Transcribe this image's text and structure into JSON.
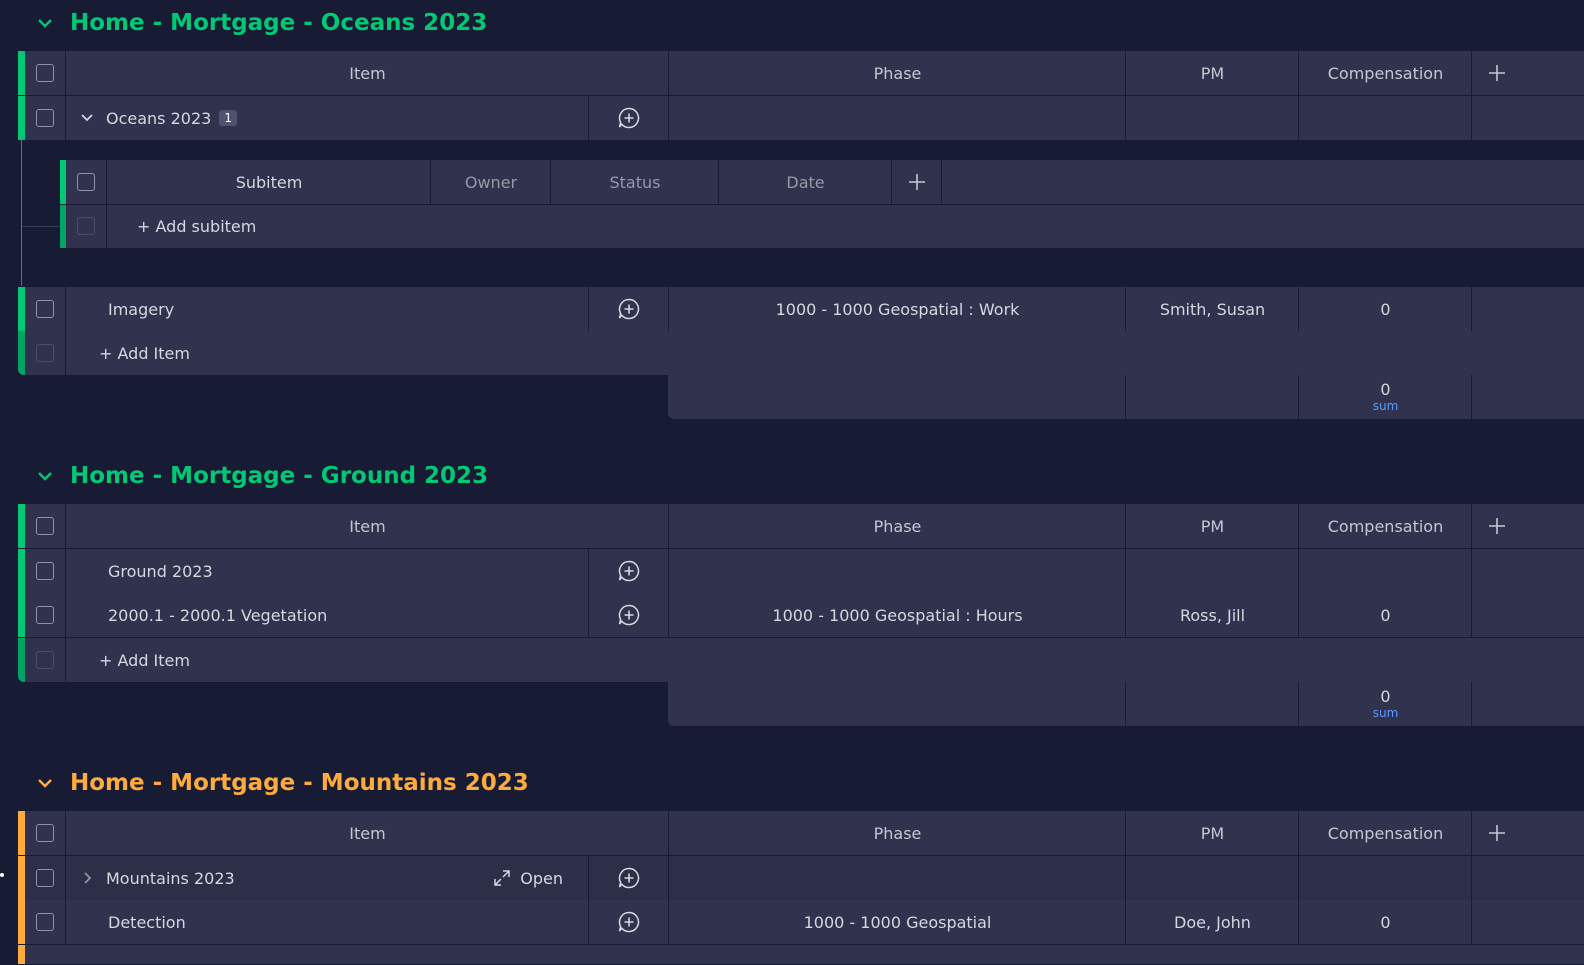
{
  "columns": {
    "item": "Item",
    "phase": "Phase",
    "pm": "PM",
    "compensation": "Compensation"
  },
  "add_item_label": "+ Add Item",
  "sum_label": "sum",
  "groups": [
    {
      "title": "Home - Mortgage - Oceans 2023",
      "color": "#00c875",
      "parent": {
        "name": "Oceans 2023",
        "subitem_count": "1"
      },
      "subtable": {
        "columns": {
          "subitem": "Subitem",
          "owner": "Owner",
          "status": "Status",
          "date": "Date"
        },
        "add_subitem_label": "+ Add subitem"
      },
      "rows": [
        {
          "name": "Imagery",
          "phase": "1000 - 1000 Geospatial : Work",
          "pm": "Smith, Susan",
          "compensation": "0"
        }
      ],
      "sum": "0"
    },
    {
      "title": "Home - Mortgage - Ground 2023",
      "color": "#00c875",
      "parent": {
        "name": "Ground 2023"
      },
      "rows": [
        {
          "name": "2000.1 - 2000.1 Vegetation",
          "phase": "1000 - 1000 Geospatial : Hours",
          "pm": "Ross, Jill",
          "compensation": "0"
        }
      ],
      "sum": "0"
    },
    {
      "title": "Home - Mortgage - Mountains 2023",
      "color": "#fdab3d",
      "parent": {
        "name": "Mountains 2023",
        "open_label": "Open"
      },
      "rows": [
        {
          "name": "Detection",
          "phase": "1000 - 1000 Geospatial",
          "pm": "Doe, John",
          "compensation": "0"
        }
      ]
    }
  ],
  "icons": {
    "collapse": "chevron-down-icon",
    "expand": "chevron-right-icon",
    "add_update": "add-update-icon",
    "add_column": "plus-icon",
    "open": "expand-arrows-icon"
  }
}
